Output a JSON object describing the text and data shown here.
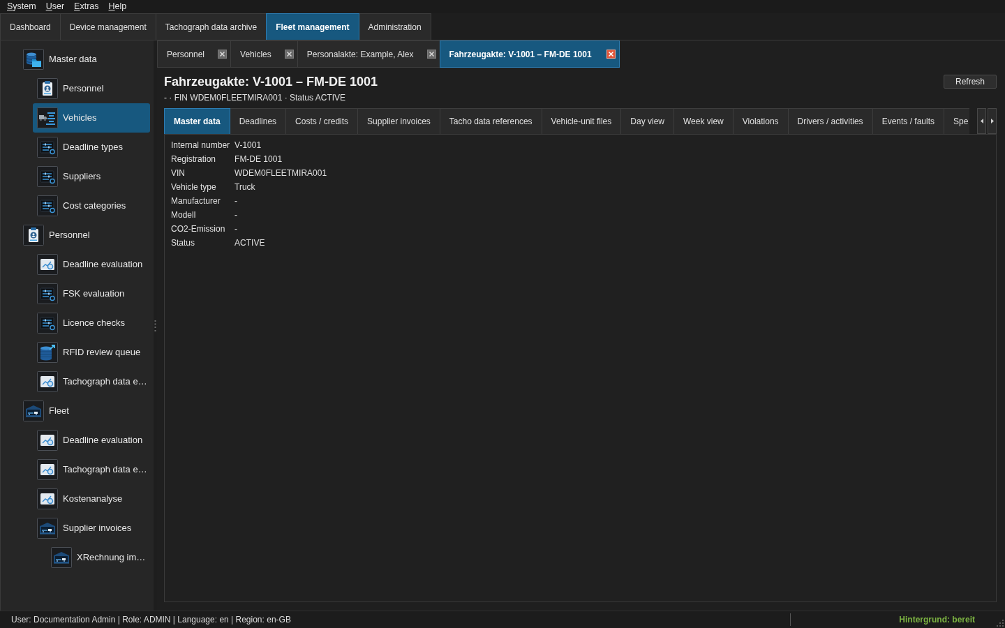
{
  "menu": [
    "System",
    "User",
    "Extras",
    "Help"
  ],
  "main_tabs": [
    {
      "label": "Dashboard",
      "selected": false
    },
    {
      "label": "Device management",
      "selected": false
    },
    {
      "label": "Tachograph data archive",
      "selected": false
    },
    {
      "label": "Fleet management",
      "selected": true
    },
    {
      "label": "Administration",
      "selected": false
    }
  ],
  "sidebar": {
    "items": [
      {
        "label": "Master data",
        "kind": "database",
        "selected": false,
        "children": [
          {
            "label": "Personnel",
            "kind": "person",
            "selected": false
          },
          {
            "label": "Vehicles",
            "kind": "vehicle",
            "selected": true
          },
          {
            "label": "Deadline types",
            "kind": "settings",
            "selected": false
          },
          {
            "label": "Suppliers",
            "kind": "settings",
            "selected": false
          },
          {
            "label": "Cost categories",
            "kind": "settings",
            "selected": false
          }
        ]
      },
      {
        "label": "Personnel",
        "kind": "person",
        "selected": false,
        "children": [
          {
            "label": "Deadline evaluation",
            "kind": "report",
            "selected": false
          },
          {
            "label": "FSK evaluation",
            "kind": "settings",
            "selected": false
          },
          {
            "label": "Licence checks",
            "kind": "settings",
            "selected": false
          },
          {
            "label": "RFID review queue",
            "kind": "export",
            "selected": false
          },
          {
            "label": "Tachograph data e…",
            "kind": "report",
            "selected": false
          }
        ]
      },
      {
        "label": "Fleet",
        "kind": "fleet",
        "selected": false,
        "children": [
          {
            "label": "Deadline evaluation",
            "kind": "report",
            "selected": false
          },
          {
            "label": "Tachograph data e…",
            "kind": "report",
            "selected": false
          },
          {
            "label": "Kostenanalyse",
            "kind": "report",
            "selected": false
          },
          {
            "label": "Supplier invoices",
            "kind": "fleet",
            "selected": false,
            "children": [
              {
                "label": "XRechnung im…",
                "kind": "fleet",
                "selected": false
              }
            ]
          }
        ]
      }
    ]
  },
  "document_tabs": [
    {
      "label": "Personnel",
      "selected": false
    },
    {
      "label": "Vehicles",
      "selected": false
    },
    {
      "label": "Personalakte: Example, Alex",
      "selected": false
    },
    {
      "label": "Fahrzeugakte: V-1001 – FM-DE 1001",
      "selected": true
    }
  ],
  "record": {
    "title": "Fahrzeugakte: V-1001 – FM-DE 1001",
    "subtitle": "- · FIN WDEM0FLEETMIRA001 · Status ACTIVE",
    "refresh_button": "Refresh",
    "tabs": [
      {
        "label": "Master data",
        "selected": true
      },
      {
        "label": "Deadlines",
        "selected": false
      },
      {
        "label": "Costs / credits",
        "selected": false
      },
      {
        "label": "Supplier invoices",
        "selected": false
      },
      {
        "label": "Tacho data references",
        "selected": false
      },
      {
        "label": "Vehicle-unit files",
        "selected": false
      },
      {
        "label": "Day view",
        "selected": false
      },
      {
        "label": "Week view",
        "selected": false
      },
      {
        "label": "Violations",
        "selected": false
      },
      {
        "label": "Drivers / activities",
        "selected": false
      },
      {
        "label": "Events / faults",
        "selected": false
      },
      {
        "label": "Spe",
        "selected": false
      }
    ],
    "fields": [
      {
        "label": "Internal number",
        "value": "V-1001"
      },
      {
        "label": "Registration",
        "value": "FM-DE 1001"
      },
      {
        "label": "VIN",
        "value": "WDEM0FLEETMIRA001"
      },
      {
        "label": "Vehicle type",
        "value": "Truck"
      },
      {
        "label": "Manufacturer",
        "value": "-"
      },
      {
        "label": "Modell",
        "value": "-"
      },
      {
        "label": "CO2-Emission",
        "value": "-"
      },
      {
        "label": "Status",
        "value": "ACTIVE"
      }
    ]
  },
  "status_bar": {
    "user_info": "User: Documentation Admin | Role: ADMIN | Language: en | Region: en-GB",
    "background_status": "Hintergrund: bereit"
  }
}
